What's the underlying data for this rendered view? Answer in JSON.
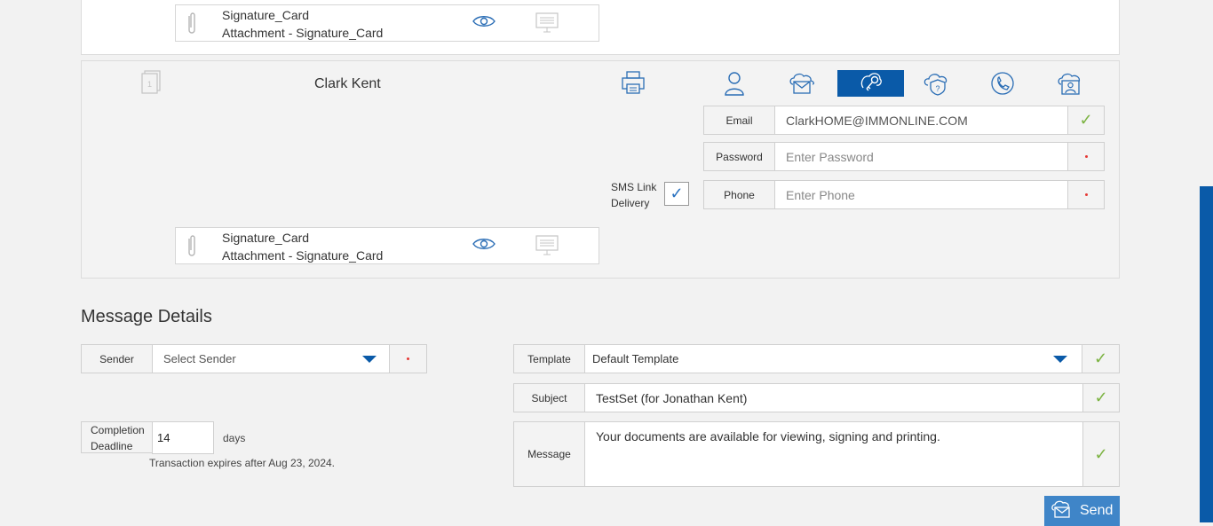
{
  "recipients": [
    {
      "name": "",
      "attachment": {
        "title": "Signature_Card",
        "subtitle": "Attachment - Signature_Card"
      }
    },
    {
      "name": "Clark Kent",
      "attachment": {
        "title": "Signature_Card",
        "subtitle": "Attachment - Signature_Card"
      },
      "auth_methods": [
        {
          "icon": "person-icon",
          "active": false
        },
        {
          "icon": "cloud-mail-icon",
          "active": false
        },
        {
          "icon": "key-icon",
          "active": true
        },
        {
          "icon": "shield-question-icon",
          "active": false
        },
        {
          "icon": "phone-icon",
          "active": false
        },
        {
          "icon": "cloud-person-icon",
          "active": false
        }
      ],
      "email": {
        "label": "Email",
        "value": "ClarkHOME@IMMONLINE.COM",
        "valid": true
      },
      "password": {
        "label": "Password",
        "placeholder": "Enter Password",
        "value": ""
      },
      "phone": {
        "label": "Phone",
        "placeholder": "Enter Phone",
        "value": ""
      },
      "sms_link_delivery": {
        "label_line1": "SMS Link",
        "label_line2": "Delivery",
        "checked": true
      }
    }
  ],
  "message_details": {
    "title": "Message Details",
    "sender": {
      "label": "Sender",
      "value": "Select Sender"
    },
    "template": {
      "label": "Template",
      "value": "Default Template"
    },
    "subject": {
      "label": "Subject",
      "value": "TestSet (for Jonathan Kent)"
    },
    "message": {
      "label": "Message",
      "value": "Your documents are available for viewing, signing and printing."
    },
    "completion_deadline": {
      "label_line1": "Completion",
      "label_line2": "Deadline",
      "value": "14",
      "unit": "days"
    },
    "expiry_text": "Transaction expires after Aug 23, 2024.",
    "send_label": "Send"
  },
  "colors": {
    "accent": "#0a5aa8",
    "send": "#3f85c8",
    "valid": "#7cb342",
    "required": "#e53935"
  }
}
